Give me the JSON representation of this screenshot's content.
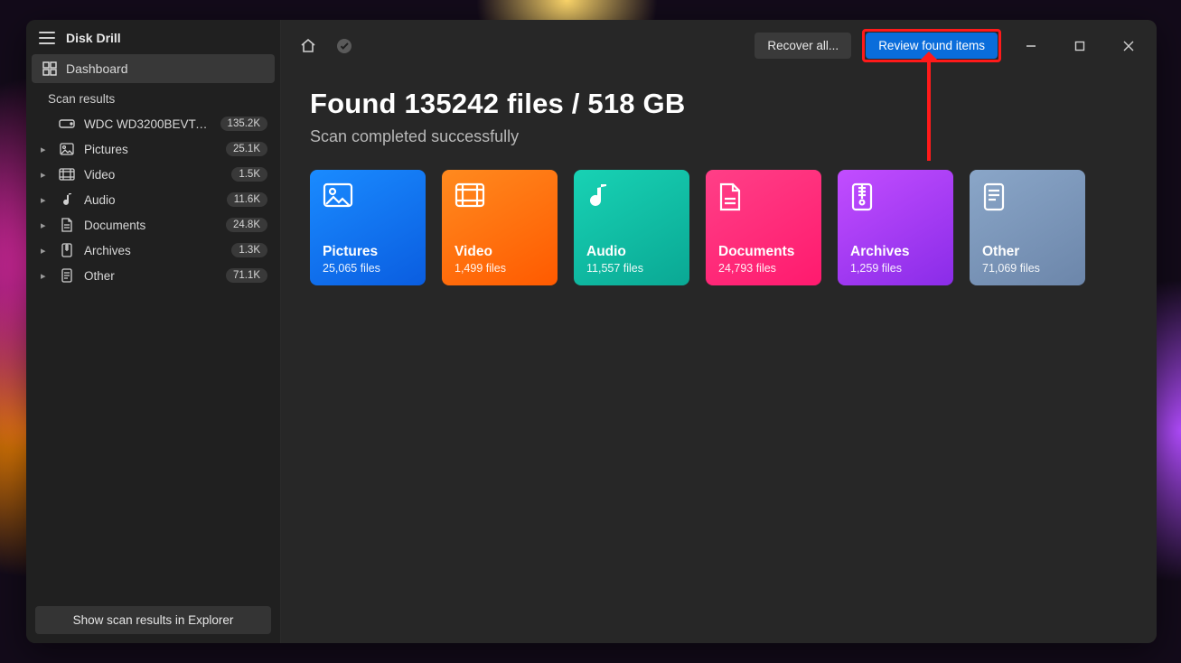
{
  "app_title": "Disk Drill",
  "sidebar": {
    "dashboard_label": "Dashboard",
    "section_label": "Scan results",
    "device": {
      "label": "WDC WD3200BEVT-2...",
      "count": "135.2K"
    },
    "items": [
      {
        "kind": "pictures",
        "label": "Pictures",
        "count": "25.1K"
      },
      {
        "kind": "video",
        "label": "Video",
        "count": "1.5K"
      },
      {
        "kind": "audio",
        "label": "Audio",
        "count": "11.6K"
      },
      {
        "kind": "documents",
        "label": "Documents",
        "count": "24.8K"
      },
      {
        "kind": "archives",
        "label": "Archives",
        "count": "1.3K"
      },
      {
        "kind": "other",
        "label": "Other",
        "count": "71.1K"
      }
    ],
    "footer_button": "Show scan results in Explorer"
  },
  "topbar": {
    "recover_label": "Recover all...",
    "review_label": "Review found items"
  },
  "summary": {
    "headline": "Found 135242 files / 518 GB",
    "subline": "Scan completed successfully"
  },
  "cards": [
    {
      "kind": "pictures",
      "title": "Pictures",
      "count": "25,065 files"
    },
    {
      "kind": "video",
      "title": "Video",
      "count": "1,499 files"
    },
    {
      "kind": "audio",
      "title": "Audio",
      "count": "11,557 files"
    },
    {
      "kind": "documents",
      "title": "Documents",
      "count": "24,793 files"
    },
    {
      "kind": "archives",
      "title": "Archives",
      "count": "1,259 files"
    },
    {
      "kind": "other",
      "title": "Other",
      "count": "71,069 files"
    }
  ]
}
